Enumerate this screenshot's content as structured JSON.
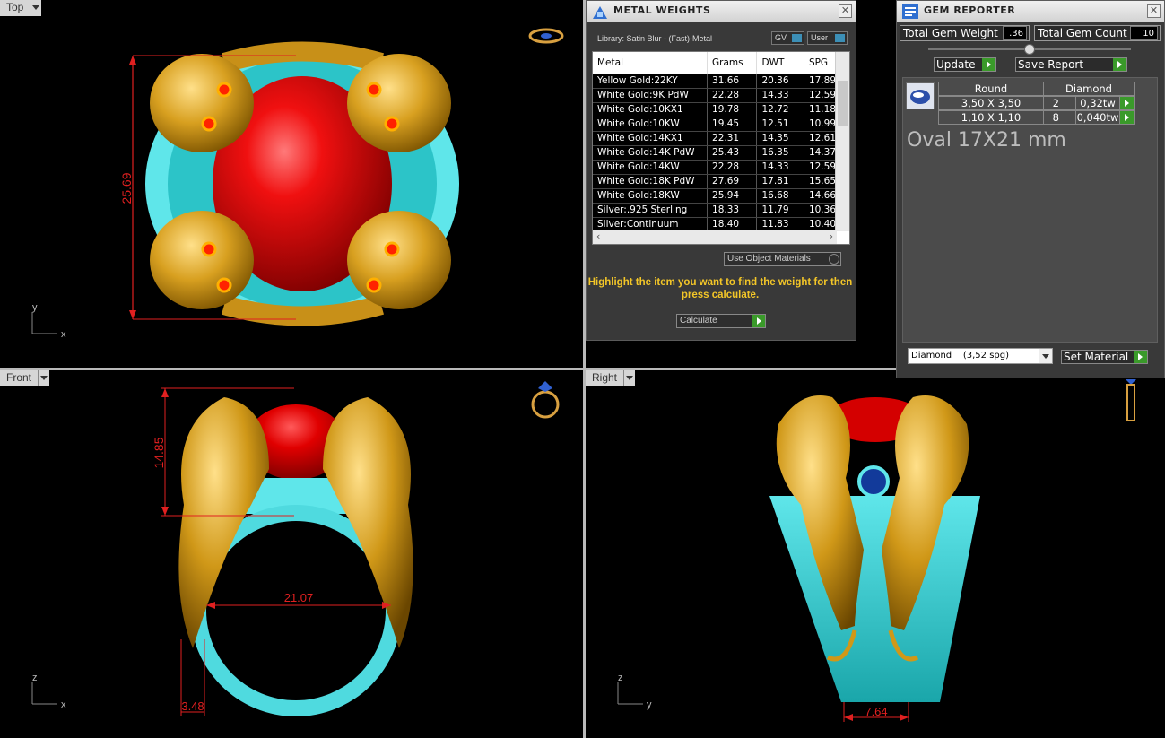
{
  "viewports": {
    "top": {
      "label": "Top",
      "dimensions": [
        "25.69"
      ],
      "axis": [
        "y",
        "x"
      ]
    },
    "front": {
      "label": "Front",
      "dimensions": [
        "14.85",
        "21.07",
        "3.48"
      ],
      "axis": [
        "z",
        "x"
      ]
    },
    "right": {
      "label": "Right",
      "dimensions": [
        "7.64"
      ],
      "axis": [
        "z",
        "y"
      ]
    }
  },
  "metal_weights": {
    "title": "METAL WEIGHTS",
    "library": "Library: Satin Blur - (Fast)-Metal",
    "gv_label": "GV",
    "user_label": "User",
    "columns": [
      "Metal",
      "Grams",
      "DWT",
      "SPG"
    ],
    "rows": [
      [
        "Yellow Gold:22KY",
        "31.66",
        "20.36",
        "17.89"
      ],
      [
        "White Gold:9K PdW",
        "22.28",
        "14.33",
        "12.59"
      ],
      [
        "White Gold:10KX1",
        "19.78",
        "12.72",
        "11.18"
      ],
      [
        "White Gold:10KW",
        "19.45",
        "12.51",
        "10.99"
      ],
      [
        "White Gold:14KX1",
        "22.31",
        "14.35",
        "12.61"
      ],
      [
        "White Gold:14K PdW",
        "25.43",
        "16.35",
        "14.37"
      ],
      [
        "White Gold:14KW",
        "22.28",
        "14.33",
        "12.59"
      ],
      [
        "White Gold:18K PdW",
        "27.69",
        "17.81",
        "15.65"
      ],
      [
        "White Gold:18KW",
        "25.94",
        "16.68",
        "14.66"
      ],
      [
        "Silver:.925 Sterling",
        "18.33",
        "11.79",
        "10.36"
      ],
      [
        "Silver:Continuum",
        "18.40",
        "11.83",
        "10.40"
      ]
    ],
    "use_object_materials": "Use Object Materials",
    "hint": "Highlight the item you want to find the weight for then press calculate.",
    "calculate": "Calculate"
  },
  "gem_reporter": {
    "title": "GEM REPORTER",
    "total_weight_label": "Total Gem Weight",
    "total_weight_value": ".36",
    "total_count_label": "Total Gem Count",
    "total_count_value": "10",
    "update": "Update",
    "save_report": "Save Report",
    "shape": "Round",
    "material": "Diamond",
    "rows": [
      {
        "size": "3,50 X 3,50",
        "count": "2",
        "weight": "0,32tw"
      },
      {
        "size": "1,10 X 1,10",
        "count": "8",
        "weight": "0,040tw"
      }
    ],
    "center_stone": "Oval 17X21 mm",
    "material_select": "Diamond    (3,52 spg)",
    "set_material": "Set Material"
  }
}
